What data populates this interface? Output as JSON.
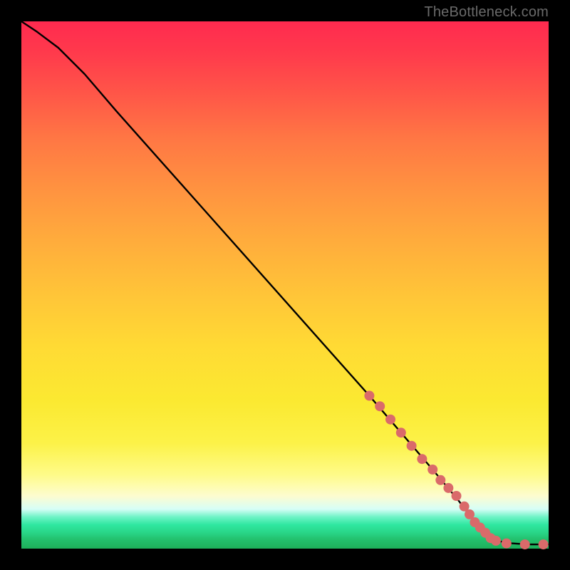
{
  "watermark": "TheBottleneck.com",
  "chart_data": {
    "type": "line",
    "title": "",
    "xlabel": "",
    "ylabel": "",
    "xlim": [
      0,
      100
    ],
    "ylim": [
      0,
      100
    ],
    "grid": false,
    "legend": false,
    "gradient_stops_pct_top_to_bottom": [
      {
        "pct": 0,
        "color": "#ff2a4f"
      },
      {
        "pct": 14,
        "color": "#ff5748"
      },
      {
        "pct": 32,
        "color": "#ff9340"
      },
      {
        "pct": 52,
        "color": "#ffc538"
      },
      {
        "pct": 72,
        "color": "#fbe931"
      },
      {
        "pct": 86,
        "color": "#fefb89"
      },
      {
        "pct": 92,
        "color": "#d7fef7"
      },
      {
        "pct": 95,
        "color": "#2fe7a0"
      },
      {
        "pct": 100,
        "color": "#1eb05a"
      }
    ],
    "series": [
      {
        "name": "bottleneck-curve",
        "color": "#000000",
        "x": [
          0,
          3,
          7,
          12,
          18,
          26,
          34,
          42,
          50,
          58,
          66,
          72,
          78,
          83,
          86,
          88,
          90,
          93,
          96,
          100
        ],
        "y": [
          100,
          98,
          95,
          90,
          83,
          74,
          65,
          56,
          47,
          38,
          29,
          22,
          15,
          9,
          5,
          3,
          1.5,
          1,
          0.8,
          0.8
        ]
      }
    ],
    "markers": {
      "name": "highlighted-segment",
      "color": "#da6a6a",
      "radius_px": 7,
      "points": [
        {
          "x": 66,
          "y": 29
        },
        {
          "x": 68,
          "y": 27
        },
        {
          "x": 70,
          "y": 24.5
        },
        {
          "x": 72,
          "y": 22
        },
        {
          "x": 74,
          "y": 19.5
        },
        {
          "x": 76,
          "y": 17
        },
        {
          "x": 78,
          "y": 15
        },
        {
          "x": 79.5,
          "y": 13
        },
        {
          "x": 81,
          "y": 11.5
        },
        {
          "x": 82.5,
          "y": 10
        },
        {
          "x": 84,
          "y": 8
        },
        {
          "x": 85,
          "y": 6.5
        },
        {
          "x": 86,
          "y": 5
        },
        {
          "x": 87,
          "y": 4
        },
        {
          "x": 88,
          "y": 3
        },
        {
          "x": 89,
          "y": 2
        },
        {
          "x": 90,
          "y": 1.5
        },
        {
          "x": 92,
          "y": 1
        },
        {
          "x": 95.5,
          "y": 0.8
        },
        {
          "x": 99,
          "y": 0.8
        }
      ]
    }
  }
}
